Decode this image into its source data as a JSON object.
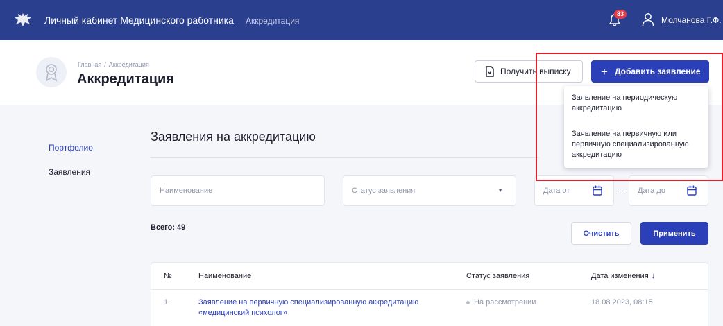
{
  "topbar": {
    "app_title": "Личный кабинет Медицинского работника",
    "section": "Аккредитация",
    "notifications_count": "83",
    "user_name": "Молчанова Г.Ф.",
    "user_caret": "▾",
    "icons": [
      "emblem-icon",
      "bell-icon",
      "user-icon"
    ]
  },
  "header": {
    "breadcrumb": [
      "Главная",
      "Аккредитация"
    ],
    "breadcrumb_sep": "/",
    "title": "Аккредитация",
    "extract_button": "Получить выписку",
    "add_button": "Добавить заявление",
    "add_button_icon": "+"
  },
  "dropdown": {
    "items": [
      "Заявление на периодическую аккредитацию",
      "Заявление на первичную или первичную специализированную аккредитацию"
    ]
  },
  "sidebar": {
    "items": [
      {
        "label": "Портфолио",
        "active": true
      },
      {
        "label": "Заявления",
        "active": false
      }
    ]
  },
  "main": {
    "title": "Заявления на аккредитацию",
    "filters": {
      "name_placeholder": "Наименование",
      "status_placeholder": "Статус заявления",
      "date_from_placeholder": "Дата от",
      "date_to_placeholder": "Дата до",
      "range_dash": "–"
    },
    "total": "Всего: 49",
    "clear_button": "Очистить",
    "apply_button": "Применить",
    "table": {
      "columns": [
        "№",
        "Наименование",
        "Статус заявления",
        "Дата изменения"
      ],
      "sort_indicator": "↓",
      "rows": [
        {
          "num": "1",
          "name": "Заявление на первичную специализированную аккредитацию «медицинский психолог»",
          "status": "На рассмотрении",
          "date": "18.08.2023, 08:15"
        }
      ]
    }
  },
  "colors": {
    "topbar": "#2b3f8f",
    "primary": "#2b3fb8",
    "badge": "#e53b4a",
    "highlight_frame": "#e0202a"
  }
}
